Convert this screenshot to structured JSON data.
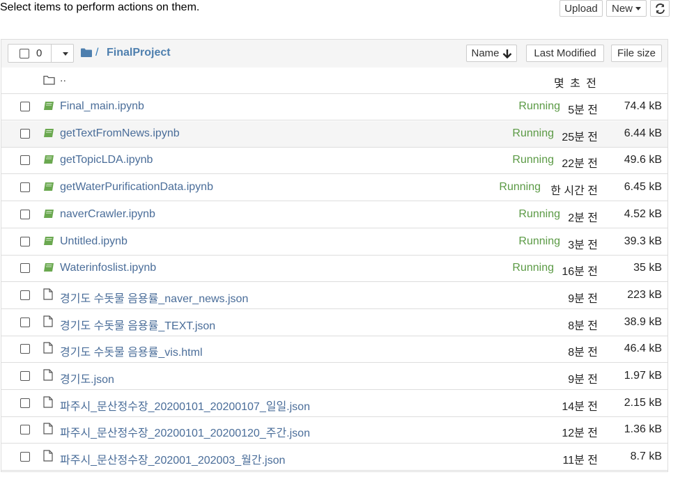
{
  "top": {
    "instruction": "Select items to perform actions on them.",
    "upload_label": "Upload",
    "new_label": "New"
  },
  "header": {
    "selected_count": "0",
    "breadcrumb_sep": "/",
    "folder_name": "FinalProject",
    "sort_name_label": "Name",
    "sort_modified_label": "Last Modified",
    "sort_size_label": "File size"
  },
  "parent_row": {
    "name": "..",
    "modified": "몇 초 전"
  },
  "rows": [
    {
      "name": "Final_main.ipynb",
      "type": "notebook",
      "status": "Running",
      "modified": "5분 전",
      "size": "74.4 kB"
    },
    {
      "name": "getTextFromNews.ipynb",
      "type": "notebook",
      "status": "Running",
      "modified": "25분 전",
      "size": "6.44 kB"
    },
    {
      "name": "getTopicLDA.ipynb",
      "type": "notebook",
      "status": "Running",
      "modified": "22분 전",
      "size": "49.6 kB"
    },
    {
      "name": "getWaterPurificationData.ipynb",
      "type": "notebook",
      "status": "Running",
      "modified": "한 시간 전",
      "size": "6.45 kB"
    },
    {
      "name": "naverCrawler.ipynb",
      "type": "notebook",
      "status": "Running",
      "modified": "2분 전",
      "size": "4.52 kB"
    },
    {
      "name": "Untitled.ipynb",
      "type": "notebook",
      "status": "Running",
      "modified": "3분 전",
      "size": "39.3 kB"
    },
    {
      "name": "Waterinfoslist.ipynb",
      "type": "notebook",
      "status": "Running",
      "modified": "16분 전",
      "size": "35 kB"
    },
    {
      "name": "경기도 수돗물 음용률_naver_news.json",
      "type": "file",
      "status": "",
      "modified": "9분 전",
      "size": "223 kB"
    },
    {
      "name": "경기도 수돗물 음용률_TEXT.json",
      "type": "file",
      "status": "",
      "modified": "8분 전",
      "size": "38.9 kB"
    },
    {
      "name": "경기도 수돗물 음용률_vis.html",
      "type": "file",
      "status": "",
      "modified": "8분 전",
      "size": "46.4 kB"
    },
    {
      "name": "경기도.json",
      "type": "file",
      "status": "",
      "modified": "9분 전",
      "size": "1.97 kB"
    },
    {
      "name": "파주시_문산정수장_20200101_20200107_일일.json",
      "type": "file",
      "status": "",
      "modified": "14분 전",
      "size": "2.15 kB"
    },
    {
      "name": "파주시_문산정수장_20200101_20200120_주간.json",
      "type": "file",
      "status": "",
      "modified": "12분 전",
      "size": "1.36 kB"
    },
    {
      "name": "파주시_문산정수장_202001_202003_월간.json",
      "type": "file",
      "status": "",
      "modified": "11분 전",
      "size": "8.7 kB"
    }
  ],
  "colors": {
    "link": "#4a6d99",
    "running": "#5b9a45",
    "notebook_icon": "#6aa84f",
    "header_bg": "#f5f5f5",
    "border": "#dddddd"
  }
}
